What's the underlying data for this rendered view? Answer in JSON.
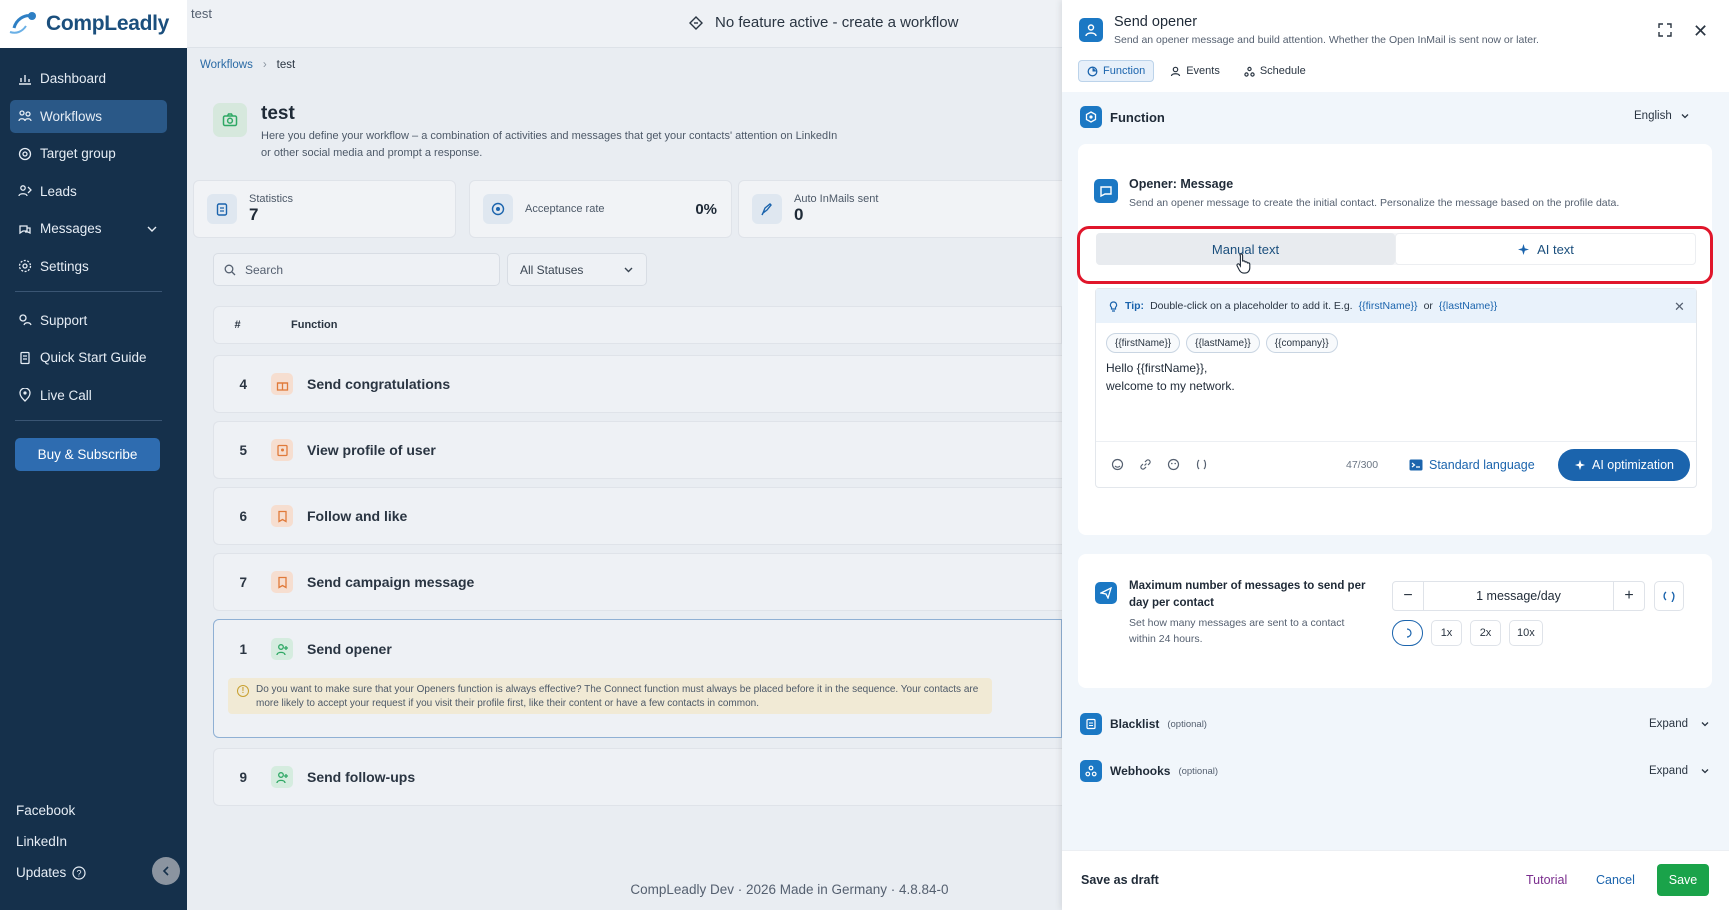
{
  "app": {
    "name": "CompLeadly",
    "top_title": "test",
    "banner": "No feature active - create a workflow"
  },
  "sidebar": {
    "items": [
      {
        "label": "Dashboard",
        "icon": "dashboard-icon"
      },
      {
        "label": "Workflows",
        "icon": "workflows-icon",
        "active": true
      },
      {
        "label": "Target group",
        "icon": "target-icon"
      },
      {
        "label": "Leads",
        "icon": "leads-icon"
      },
      {
        "label": "Messages",
        "icon": "messages-icon"
      },
      {
        "label": "Settings",
        "icon": "settings-icon"
      }
    ],
    "secondary": [
      {
        "label": "Support",
        "icon": "support-icon"
      },
      {
        "label": "Quick Start Guide",
        "icon": "guide-icon"
      },
      {
        "label": "Live Call",
        "icon": "live-call-icon"
      }
    ],
    "buy_label": "Buy & Subscribe",
    "bottom": {
      "facebook": "Facebook",
      "linkedin": "LinkedIn",
      "updates": "Updates"
    }
  },
  "main": {
    "breadcrumb": {
      "root": "Workflows",
      "current": "test"
    },
    "title": "test",
    "description": "Here you define your workflow – a combination of activities and messages that get your contacts' attention on LinkedIn or other social media and prompt a response.",
    "stats": [
      {
        "label": "Statistics",
        "value": "7"
      },
      {
        "label": "Acceptance rate",
        "value": "0%"
      },
      {
        "label": "Auto InMails sent",
        "value": "0"
      }
    ],
    "search_placeholder": "Search",
    "status_filter": "All Statuses",
    "table_headers": {
      "num": "#",
      "function": "Function"
    },
    "rows": [
      {
        "num": "4",
        "label": "Send congratulations",
        "color": "#e07a3a"
      },
      {
        "num": "5",
        "label": "View profile of user",
        "color": "#e07a3a"
      },
      {
        "num": "6",
        "label": "Follow and like",
        "color": "#e07a3a"
      },
      {
        "num": "7",
        "label": "Send campaign message",
        "color": "#e07a3a"
      },
      {
        "num": "1",
        "label": "Send opener",
        "color": "#2fa865",
        "warning": "Do you want to make sure that your Openers function is always effective? The Connect function must always be placed before it in the sequence. Your contacts are more likely to accept your request if you visit their profile first, like their content or have a few contacts in common."
      },
      {
        "num": "9",
        "label": "Send follow-ups",
        "color": "#2fa865"
      }
    ],
    "footer": "CompLeadly Dev · 2026 Made in Germany · 4.8.84-0"
  },
  "panel": {
    "title": "Send opener",
    "subtitle": "Send an opener message and build attention. Whether the Open InMail is sent now or later.",
    "tabs": [
      "Function",
      "Events",
      "Schedule"
    ],
    "section_title": "Function",
    "language": "English",
    "opener": {
      "title": "Opener: Message",
      "subtitle": "Send an opener message to create the initial contact. Personalize the message based on the profile data.",
      "manual_label": "Manual text",
      "ai_label": "AI text",
      "tip_label": "Tip:",
      "tip_text": "Double-click on a placeholder to add it. E.g.",
      "tip_ph1": "{{firstName}}",
      "tip_or": "or",
      "tip_ph2": "{{lastName}}",
      "chips": [
        "{{firstName}}",
        "{{lastName}}",
        "{{company}}"
      ],
      "message": "Hello {{firstName}},\nwelcome to my network.",
      "counter": "47/300",
      "standard_language": "Standard language",
      "ai_optimization": "AI optimization"
    },
    "max_messages": {
      "title": "Maximum number of messages to send per day per contact",
      "subtitle": "Set how many messages are sent to a contact within 24 hours.",
      "value": "1 message/day",
      "presets": [
        "1x",
        "2x",
        "10x"
      ]
    },
    "blacklist": {
      "label": "Blacklist",
      "optional": "(optional)",
      "expand": "Expand"
    },
    "webhooks": {
      "label": "Webhooks",
      "optional": "(optional)",
      "expand": "Expand"
    },
    "footer": {
      "draft": "Save as draft",
      "tutorial": "Tutorial",
      "cancel": "Cancel",
      "save": "Save"
    }
  }
}
